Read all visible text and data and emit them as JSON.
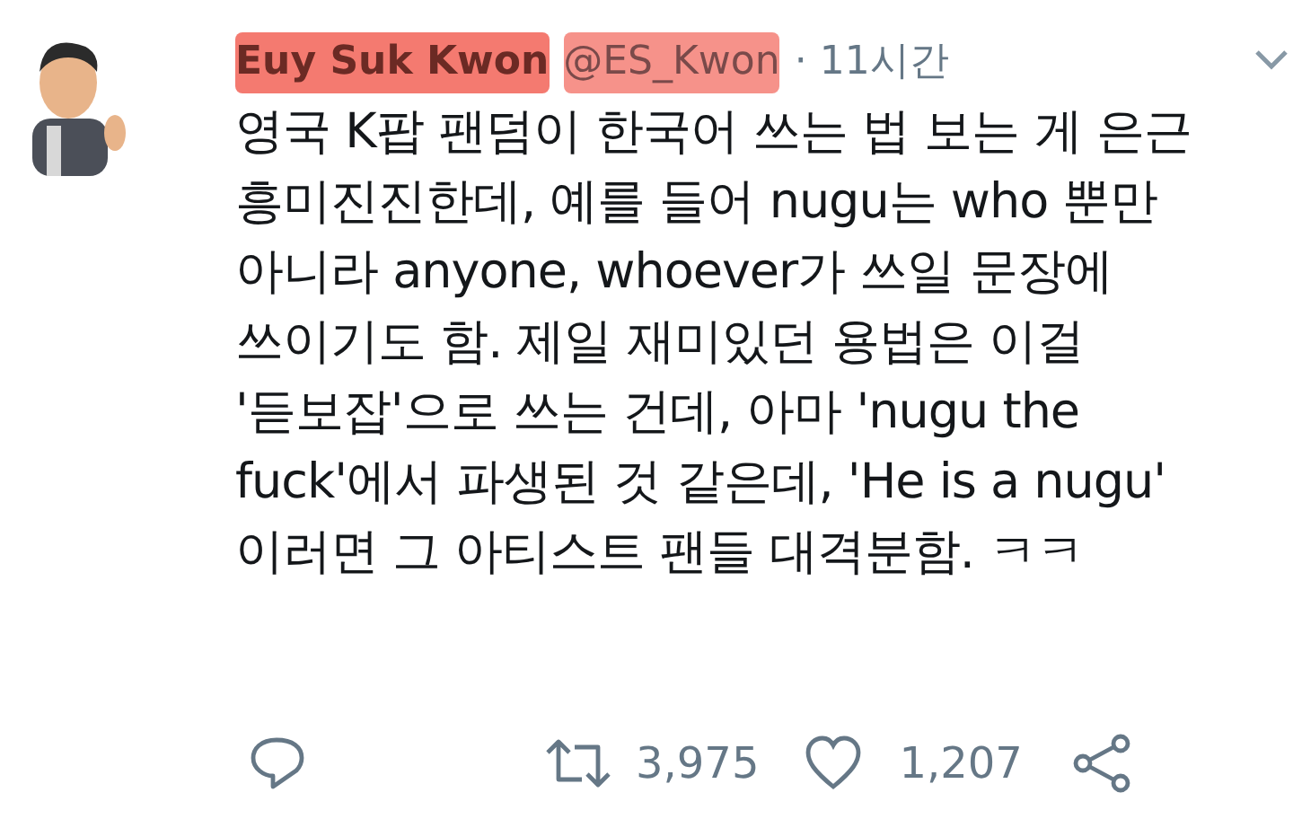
{
  "tweet": {
    "name": "Euy Suk Kwon",
    "handle": "@ES_Kwon",
    "time": "· 11시간",
    "lines": [
      "영국 K팝 팬덤이 한국어 쓰는 법 보는 게 은근",
      "흥미진진한데, 예를 들어 nugu는 who 뿐만",
      "아니라 anyone, whoever가 쓰일 문장에",
      "쓰이기도 함. 제일 재미있던 용법은 이걸",
      "'듣보잡'으로 쓰는 건데, 아마 'nugu the",
      "fuck'에서 파생된 것 같은데, 'He is a nugu'",
      "이러면 그 아티스트 팬들 대격분함. ㅋㅋ"
    ],
    "retweets": "3,975",
    "likes": "1,207"
  }
}
